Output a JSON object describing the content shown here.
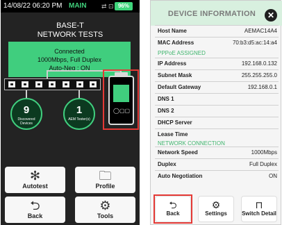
{
  "left": {
    "status": {
      "datetime": "14/08/22 06:20 PM",
      "mode": "MAIN",
      "icons": "⇄ ⊡",
      "battery": "96%"
    },
    "title_line1": "BASE-T",
    "title_line2": "NETWORK TESTS",
    "connection": {
      "line1": "Connected",
      "line2": "1000Mbps, Full Duplex",
      "line3": "Auto-Neg : ON"
    },
    "discovered": {
      "count": "9",
      "label": "Discovered Devices"
    },
    "aem": {
      "count": "1",
      "label": "AEM Tester(s)"
    },
    "tester_buttons": "◯▢▢",
    "buttons": {
      "autotest": "Autotest",
      "profile": "Profile",
      "back": "Back",
      "tools": "Tools"
    }
  },
  "right": {
    "title": "DEVICE INFORMATION",
    "close": "✕",
    "rows_top": [
      {
        "key": "Host Name",
        "value": "AEMAC14A4"
      },
      {
        "key": "MAC Address",
        "value": "70:b3:d5:ac:14:a4"
      }
    ],
    "pppoe_heading": "PPPoE ASSIGNED",
    "rows_pppoe": [
      {
        "key": "IP Address",
        "value": "192.168.0.132"
      },
      {
        "key": "Subnet Mask",
        "value": "255.255.255.0"
      },
      {
        "key": "Default Gateway",
        "value": "192.168.0.1"
      },
      {
        "key": "DNS 1",
        "value": ""
      },
      {
        "key": "DNS 2",
        "value": ""
      },
      {
        "key": "DHCP Server",
        "value": ""
      },
      {
        "key": "Lease Time",
        "value": ""
      }
    ],
    "network_heading": "NETWORK CONNECTION",
    "rows_network": [
      {
        "key": "Network Speed",
        "value": "1000Mbps"
      },
      {
        "key": "Duplex",
        "value": "Full Duplex"
      },
      {
        "key": "Auto Negotiation",
        "value": "ON"
      }
    ],
    "buttons": {
      "back": "Back",
      "settings": "Settings",
      "switch_detail": "Switch Detail"
    }
  },
  "colors": {
    "accent": "#40ce7e",
    "highlight": "#e53935",
    "dark_bg": "#232323"
  }
}
